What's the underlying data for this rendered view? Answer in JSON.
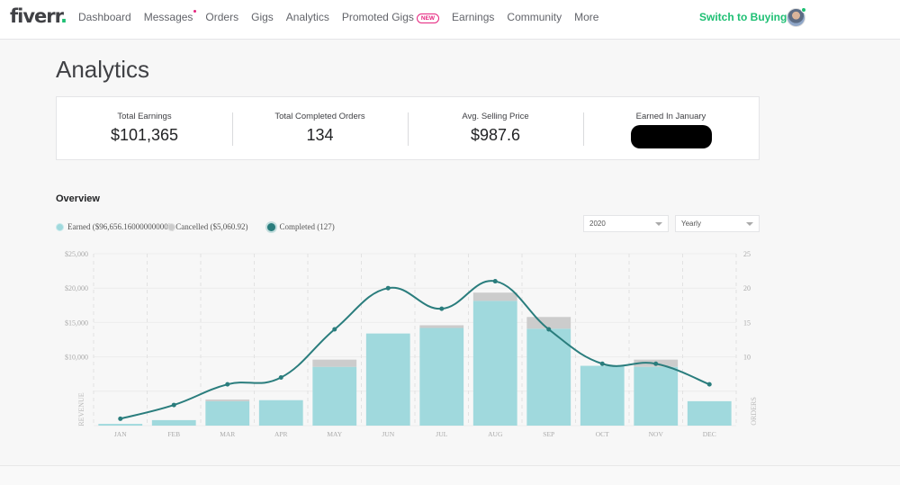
{
  "header": {
    "logo": "fiverr",
    "logo_dot": ".",
    "nav": [
      {
        "label": "Dashboard",
        "notification": false
      },
      {
        "label": "Messages",
        "notification": true
      },
      {
        "label": "Orders",
        "notification": false
      },
      {
        "label": "Gigs",
        "notification": false
      },
      {
        "label": "Analytics",
        "notification": false
      },
      {
        "label": "Promoted Gigs",
        "notification": false,
        "badge": "NEW"
      },
      {
        "label": "Earnings",
        "notification": false
      },
      {
        "label": "Community",
        "notification": false
      },
      {
        "label": "More",
        "notification": false
      }
    ],
    "switch_label": "Switch to Buying",
    "avatar_status": "online"
  },
  "page": {
    "title": "Analytics"
  },
  "stats": [
    {
      "label": "Total Earnings",
      "value": "$101,365"
    },
    {
      "label": "Total Completed Orders",
      "value": "134"
    },
    {
      "label": "Avg. Selling Price",
      "value": "$987.6"
    },
    {
      "label": "Earned In January",
      "value": null,
      "redacted": true
    }
  ],
  "overview": {
    "title": "Overview",
    "legend": [
      {
        "label": "Earned",
        "value": "($96,656.160000000002)"
      },
      {
        "label": "Cancelled",
        "value": "($5,060.92)"
      },
      {
        "label": "Completed",
        "value": "(127)"
      }
    ],
    "year_select": "2020",
    "period_select": "Yearly"
  },
  "colors": {
    "brand_green": "#1dbf73",
    "notification_pink": "#e5247e",
    "earned_bar": "#a0d9dd",
    "cancelled_bar": "#cccccc",
    "orders_line": "#2a7d7d"
  },
  "chart_data": {
    "type": "bar",
    "title": "",
    "xlabel": "",
    "ylabel": "REVENUE",
    "y2label": "ORDERS",
    "categories": [
      "JAN",
      "FEB",
      "MAR",
      "APR",
      "MAY",
      "JUN",
      "JUL",
      "AUG",
      "SEP",
      "OCT",
      "NOV",
      "DEC"
    ],
    "series": [
      {
        "name": "Earned",
        "kind": "bar",
        "stack": "revenue",
        "axis": "left",
        "values": [
          250,
          800,
          3550,
          3700,
          8550,
          13400,
          14200,
          18150,
          14100,
          8700,
          8550,
          3550
        ]
      },
      {
        "name": "Cancelled",
        "kind": "bar",
        "stack": "revenue",
        "axis": "left",
        "values": [
          0,
          0,
          250,
          0,
          1050,
          0,
          400,
          1200,
          1700,
          0,
          1050,
          0
        ]
      },
      {
        "name": "Completed",
        "kind": "line",
        "axis": "right",
        "values": [
          1,
          3,
          6,
          7,
          14,
          20,
          17,
          21,
          14,
          9,
          9,
          6
        ]
      }
    ],
    "ylim": [
      0,
      25000
    ],
    "y_ticks": [
      0,
      5000,
      10000,
      15000,
      20000,
      25000
    ],
    "y_tick_labels": [
      "",
      "",
      "$10,000",
      "$15,000",
      "$20,000",
      "$25,000"
    ],
    "y2lim": [
      0,
      25
    ],
    "y2_ticks": [
      0,
      5,
      10,
      15,
      20,
      25
    ],
    "y2_tick_labels": [
      "",
      "",
      "10",
      "15",
      "20",
      "25"
    ],
    "grid": true,
    "legend_position": "top-left"
  }
}
